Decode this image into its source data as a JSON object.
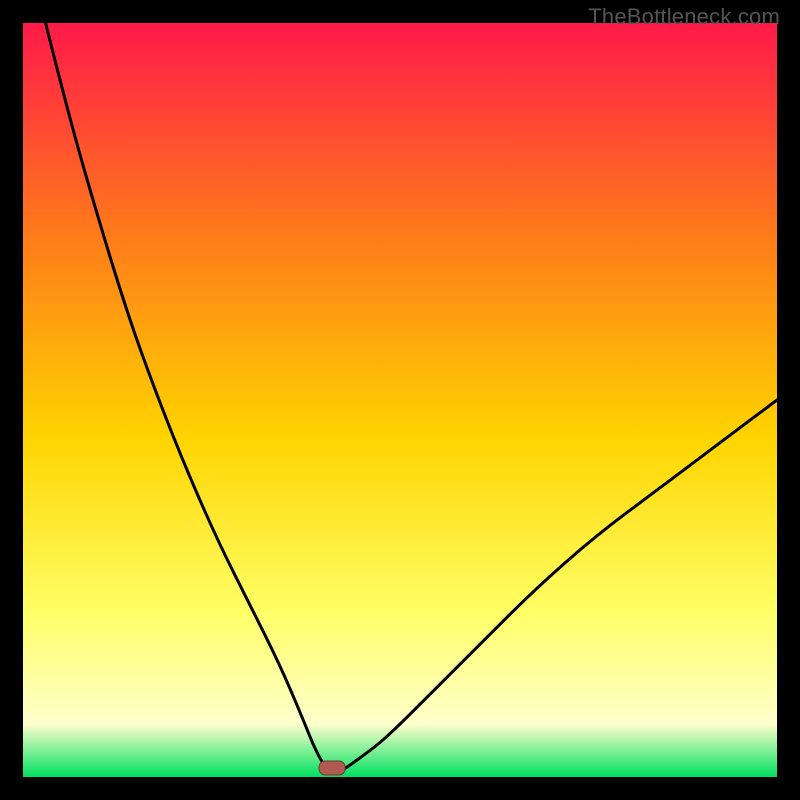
{
  "watermark": "TheBottleneck.com",
  "colors": {
    "frame": "#000000",
    "curve": "#000000",
    "marker_fill": "#b05a52",
    "marker_stroke": "#6d3a34",
    "gradient_top": "#ff1a4a",
    "gradient_mid_upper": "#ff7a1a",
    "gradient_mid": "#ffd400",
    "gradient_mid_lower": "#ffff66",
    "gradient_cream": "#ffffcc",
    "gradient_bottom": "#00e060"
  },
  "chart_data": {
    "type": "line",
    "title": "",
    "xlabel": "",
    "ylabel": "",
    "xlim": [
      0,
      100
    ],
    "ylim": [
      0,
      100
    ],
    "grid": false,
    "legend": false,
    "notes": "V-shaped bottleneck curve over a vertical red→orange→yellow→cream→green gradient. Minimum (bottleneck ≈ 0) near x≈41. Left branch is steeper and reaches ≈100 at x≈3; right branch is gentler and reaches ≈50 at x=100. A small rounded red marker sits at the minimum.",
    "series": [
      {
        "name": "bottleneck-curve",
        "x": [
          3,
          6,
          10,
          14,
          18,
          22,
          26,
          30,
          34,
          37,
          39,
          41,
          44,
          48,
          54,
          60,
          68,
          76,
          84,
          92,
          100
        ],
        "y": [
          100,
          88,
          74,
          61,
          50,
          40,
          31,
          23,
          15,
          8,
          3,
          0,
          2,
          5,
          11,
          17,
          25,
          32,
          38,
          44,
          50
        ]
      }
    ],
    "marker": {
      "x": 41,
      "y": 0
    }
  }
}
